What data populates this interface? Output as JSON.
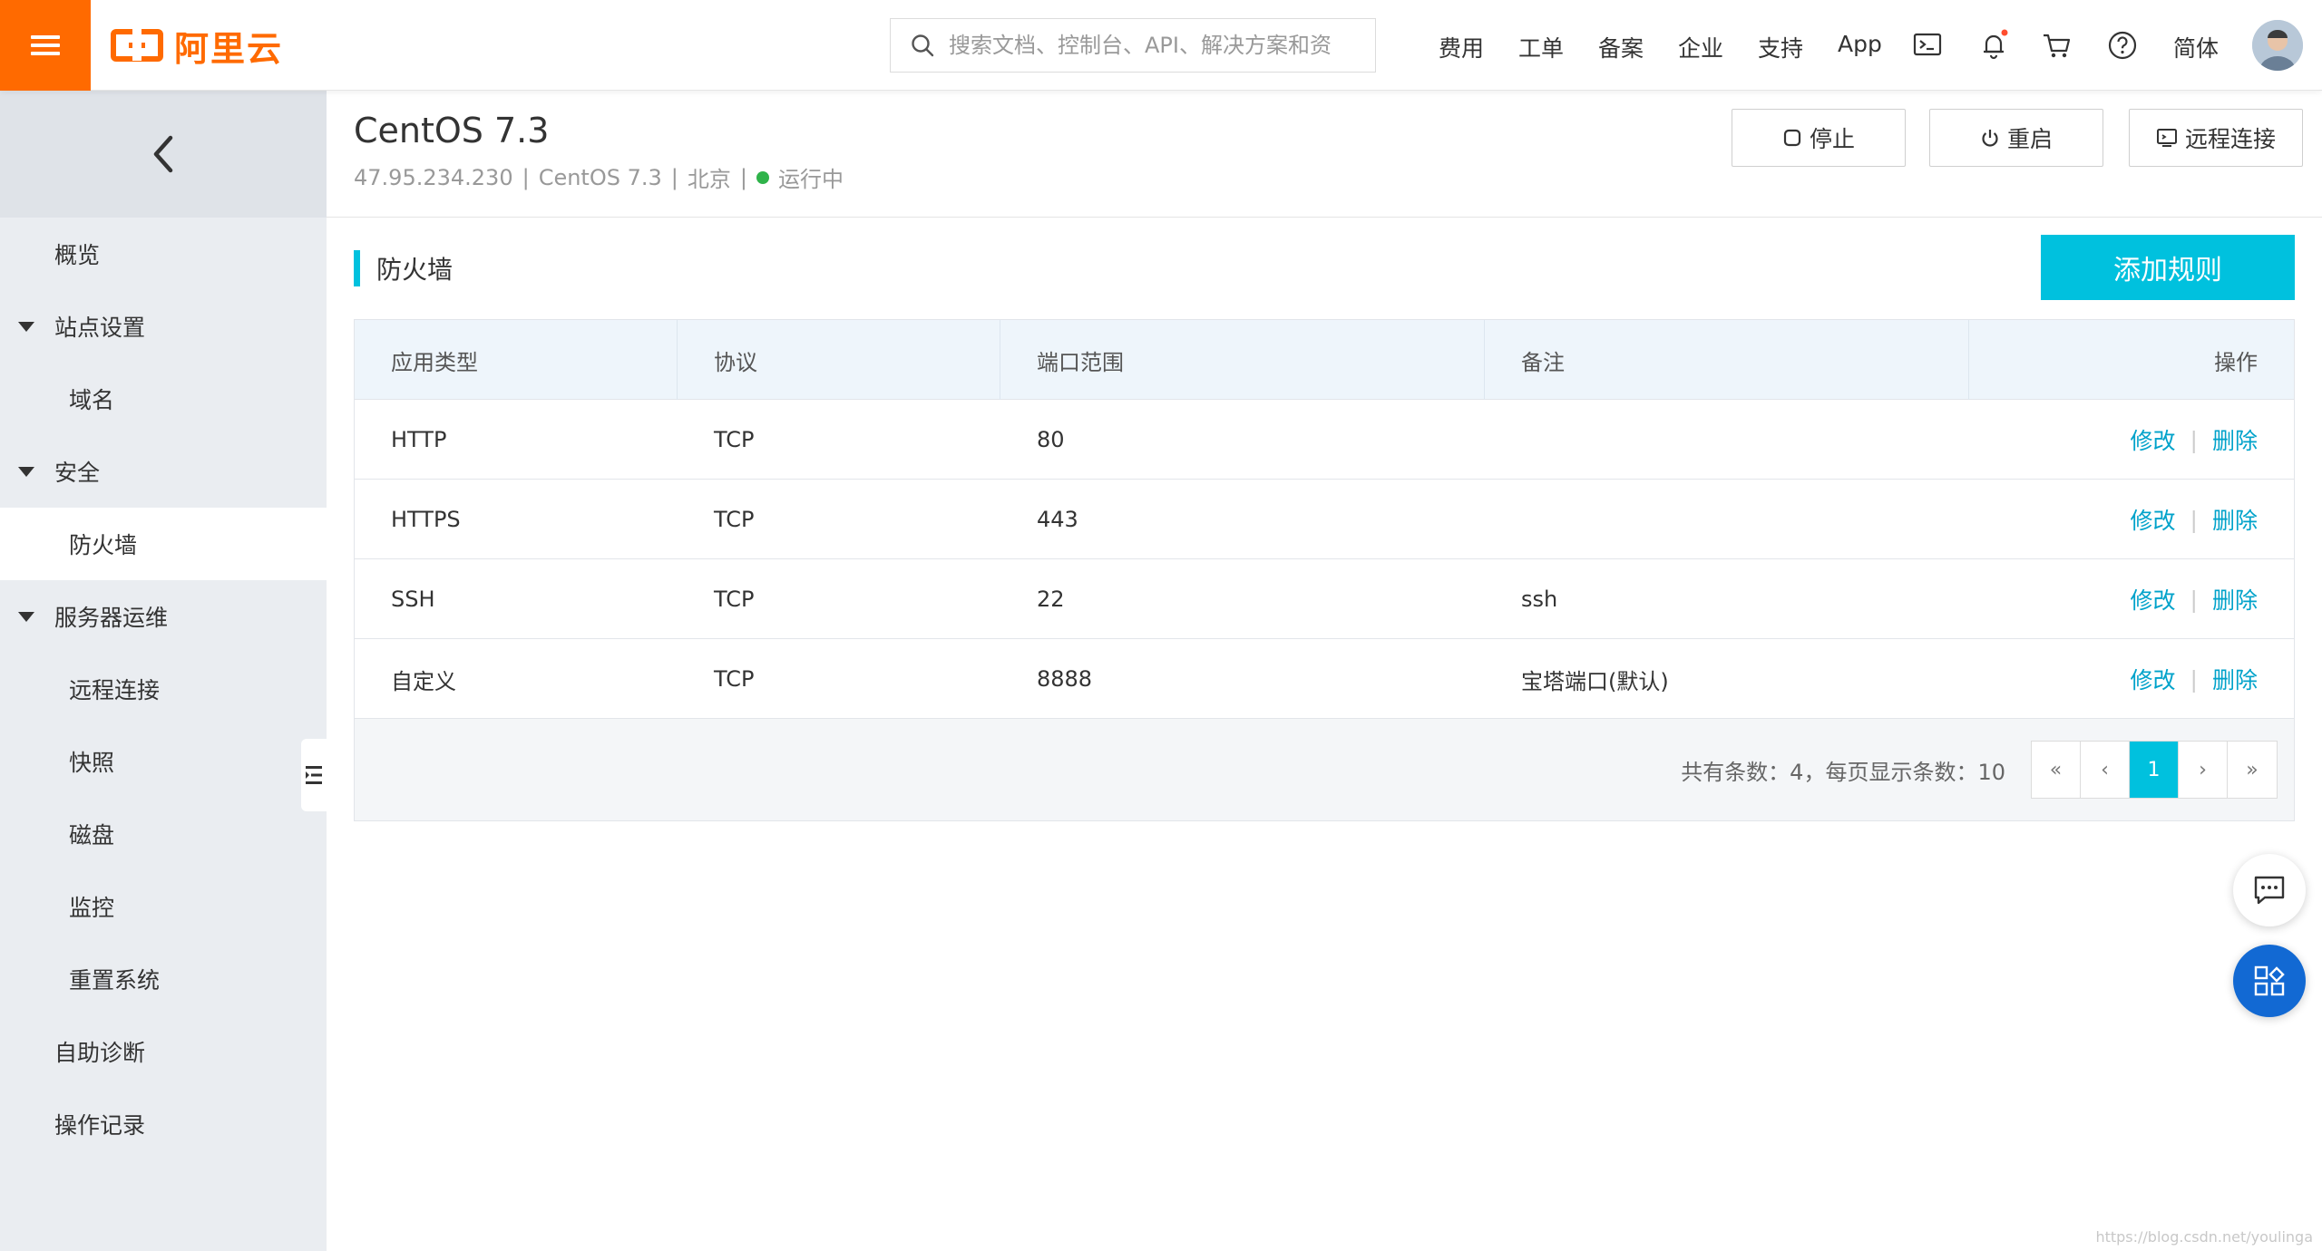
{
  "topbar": {
    "logo_text": "阿里云",
    "search_placeholder": "搜索文档、控制台、API、解决方案和资",
    "nav": [
      "费用",
      "工单",
      "备案",
      "企业",
      "支持",
      "App"
    ],
    "lang": "简体",
    "brand_color": "#ff6a00"
  },
  "sidebar": {
    "items": [
      {
        "label": "概览"
      },
      {
        "label": "站点设置"
      },
      {
        "label": "域名"
      },
      {
        "label": "安全"
      },
      {
        "label": "防火墙"
      },
      {
        "label": "服务器运维"
      },
      {
        "label": "远程连接"
      },
      {
        "label": "快照"
      },
      {
        "label": "磁盘"
      },
      {
        "label": "监控"
      },
      {
        "label": "重置系统"
      },
      {
        "label": "自助诊断"
      },
      {
        "label": "操作记录"
      }
    ]
  },
  "server": {
    "title": "CentOS 7.3",
    "ip": "47.95.234.230",
    "os": "CentOS 7.3",
    "region": "北京",
    "status": "运行中",
    "sep": "|"
  },
  "actions": {
    "stop": "停止",
    "restart": "重启",
    "remote": "远程连接"
  },
  "firewall": {
    "section_title": "防火墙",
    "add_button": "添加规则",
    "accent_color": "#00c1de",
    "columns": [
      "应用类型",
      "协议",
      "端口范围",
      "备注",
      "操作"
    ],
    "rows": [
      {
        "type": "HTTP",
        "protocol": "TCP",
        "port": "80",
        "note": ""
      },
      {
        "type": "HTTPS",
        "protocol": "TCP",
        "port": "443",
        "note": ""
      },
      {
        "type": "SSH",
        "protocol": "TCP",
        "port": "22",
        "note": "ssh"
      },
      {
        "type": "自定义",
        "protocol": "TCP",
        "port": "8888",
        "note": "宝塔端口(默认)"
      }
    ],
    "edit_label": "修改",
    "delete_label": "删除",
    "op_sep": "|"
  },
  "pagination": {
    "summary": "共有条数：4，每页显示条数：10",
    "first": "«",
    "prev": "‹",
    "current": "1",
    "next": "›",
    "last": "»"
  },
  "watermark": "https://blog.csdn.net/youlinga"
}
